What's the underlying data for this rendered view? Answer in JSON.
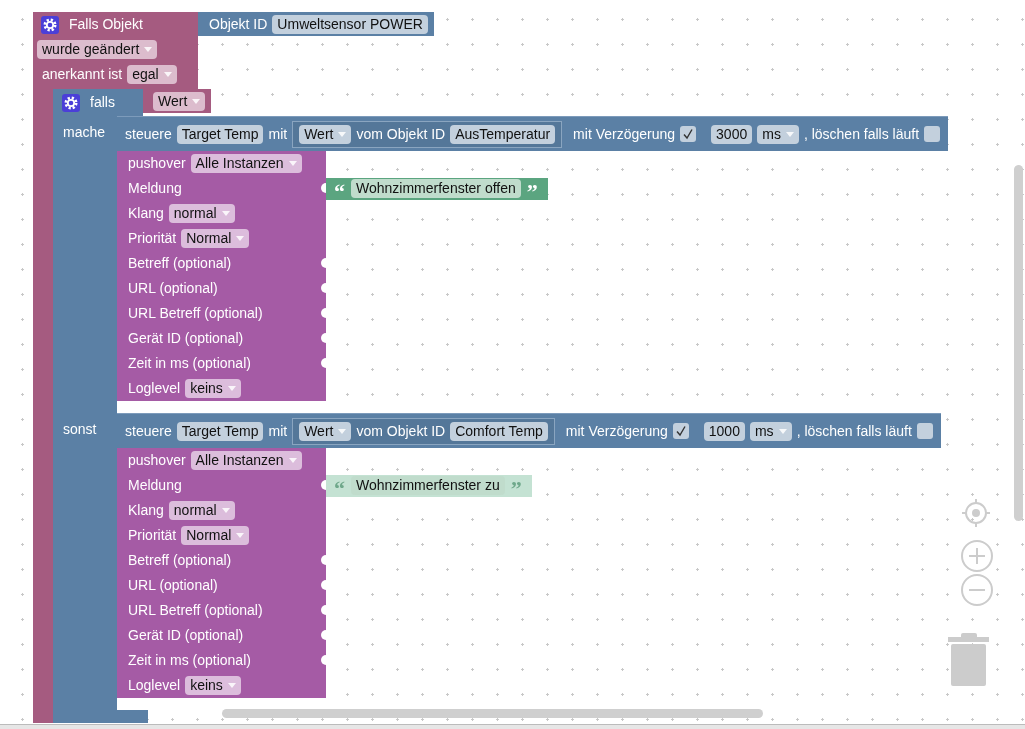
{
  "trigger": {
    "title": "Falls Objekt",
    "object_block": {
      "label": "Objekt ID",
      "value": "Umweltsensor POWER"
    },
    "event": "wurde geändert",
    "ack_label": "anerkannt ist",
    "ack": "egal"
  },
  "if_block": {
    "label": "falls",
    "condition": "Wert",
    "branches": [
      {
        "label": "mache",
        "control": {
          "label": "steuere",
          "target": "Target Temp",
          "with_label": "mit",
          "value": "Wert",
          "from_label": "vom Objekt ID",
          "object_id": "AusTemperatur",
          "delay_label": "mit Verzögerung",
          "delay_checked": true,
          "delay": "3000",
          "unit": "ms",
          "clear_label": ", löschen falls läuft",
          "clear_checked": false
        },
        "pushover": {
          "rows": [
            {
              "kind": "dropdown",
              "label": "pushover",
              "value": "Alle Instanzen"
            },
            {
              "kind": "text_input",
              "label": "Meldung",
              "open_quote": "“",
              "value": "Wohnzimmerfenster offen",
              "close_quote": "”",
              "disabled": false
            },
            {
              "kind": "dropdown",
              "label": "Klang",
              "value": "normal"
            },
            {
              "kind": "dropdown",
              "label": "Priorität",
              "value": "Normal"
            },
            {
              "kind": "socket",
              "label": "Betreff (optional)"
            },
            {
              "kind": "socket",
              "label": "URL (optional)"
            },
            {
              "kind": "socket",
              "label": "URL Betreff (optional)"
            },
            {
              "kind": "socket",
              "label": "Gerät ID (optional)"
            },
            {
              "kind": "socket",
              "label": "Zeit in ms (optional)"
            },
            {
              "kind": "dropdown",
              "label": "Loglevel",
              "value": "keins"
            }
          ]
        }
      },
      {
        "label": "sonst",
        "control": {
          "label": "steuere",
          "target": "Target Temp",
          "with_label": "mit",
          "value": "Wert",
          "from_label": "vom Objekt ID",
          "object_id": "Comfort Temp",
          "delay_label": "mit Verzögerung",
          "delay_checked": true,
          "delay": "1000",
          "unit": "ms",
          "clear_label": ", löschen falls läuft",
          "clear_checked": false
        },
        "pushover": {
          "rows": [
            {
              "kind": "dropdown",
              "label": "pushover",
              "value": "Alle Instanzen"
            },
            {
              "kind": "text_input",
              "label": "Meldung",
              "open_quote": "“",
              "value": "Wohnzimmerfenster zu",
              "close_quote": "”",
              "disabled": true
            },
            {
              "kind": "dropdown",
              "label": "Klang",
              "value": "normal"
            },
            {
              "kind": "dropdown",
              "label": "Priorität",
              "value": "Normal"
            },
            {
              "kind": "socket",
              "label": "Betreff (optional)"
            },
            {
              "kind": "socket",
              "label": "URL (optional)"
            },
            {
              "kind": "socket",
              "label": "URL Betreff (optional)"
            },
            {
              "kind": "socket",
              "label": "Gerät ID (optional)"
            },
            {
              "kind": "socket",
              "label": "Zeit in ms (optional)"
            },
            {
              "kind": "dropdown",
              "label": "Loglevel",
              "value": "keins"
            }
          ]
        }
      }
    ]
  }
}
